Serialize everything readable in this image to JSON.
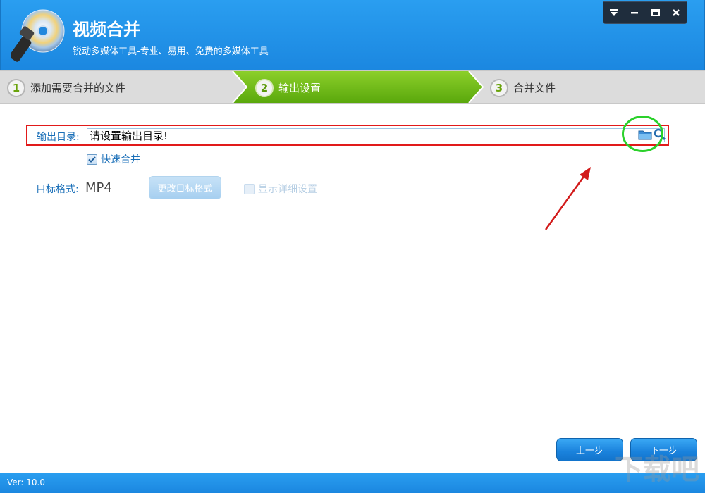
{
  "app": {
    "title": "视频合并",
    "subtitle": "锐动多媒体工具-专业、易用、免费的多媒体工具"
  },
  "window_controls": [
    "menu-icon",
    "minimize-icon",
    "maximize-icon",
    "close-icon"
  ],
  "steps": [
    {
      "number": "1",
      "label": "添加需要合并的文件",
      "active": false
    },
    {
      "number": "2",
      "label": "输出设置",
      "active": true
    },
    {
      "number": "3",
      "label": "合并文件",
      "active": false
    }
  ],
  "output": {
    "label": "输出目录:",
    "value": "请设置输出目录!"
  },
  "fast_merge": {
    "label": "快速合并",
    "checked": true
  },
  "target_format": {
    "label": "目标格式:",
    "value": "MP4",
    "change_button": "更改目标格式"
  },
  "show_detail": {
    "label": "显示详细设置",
    "checked": false,
    "enabled": false
  },
  "nav": {
    "prev": "上一步",
    "next": "下一步"
  },
  "footer": {
    "version": "Ver: 10.0"
  },
  "colors": {
    "header": "#1b87e0",
    "active_step": "#6ab514",
    "highlight_box": "#e11a1a",
    "highlight_circle": "#2bd12b"
  }
}
